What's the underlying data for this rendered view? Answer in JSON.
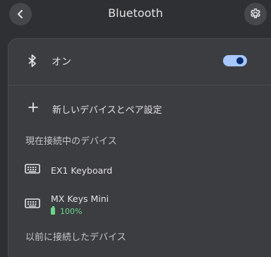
{
  "header": {
    "title": "Bluetooth",
    "back_icon": "chevron-left-icon",
    "settings_icon": "gear-icon"
  },
  "bluetooth": {
    "label": "オン",
    "enabled": true,
    "icon": "bluetooth-icon"
  },
  "pair_new": {
    "label": "新しいデバイスとペア設定",
    "icon": "plus-icon"
  },
  "sections": {
    "current": "現在接続中のデバイス",
    "previous": "以前に接続したデバイス"
  },
  "devices": [
    {
      "name": "EX1 Keyboard",
      "icon": "keyboard-icon"
    },
    {
      "name": "MX Keys Mini",
      "icon": "keyboard-icon",
      "battery": "100%",
      "battery_level": 1.0
    }
  ],
  "colors": {
    "background": "#2f3033",
    "panel": "#3c3d41",
    "toggle_track": "#a8c7fa",
    "toggle_knob": "#062e6f",
    "battery": "#6dd58c"
  }
}
